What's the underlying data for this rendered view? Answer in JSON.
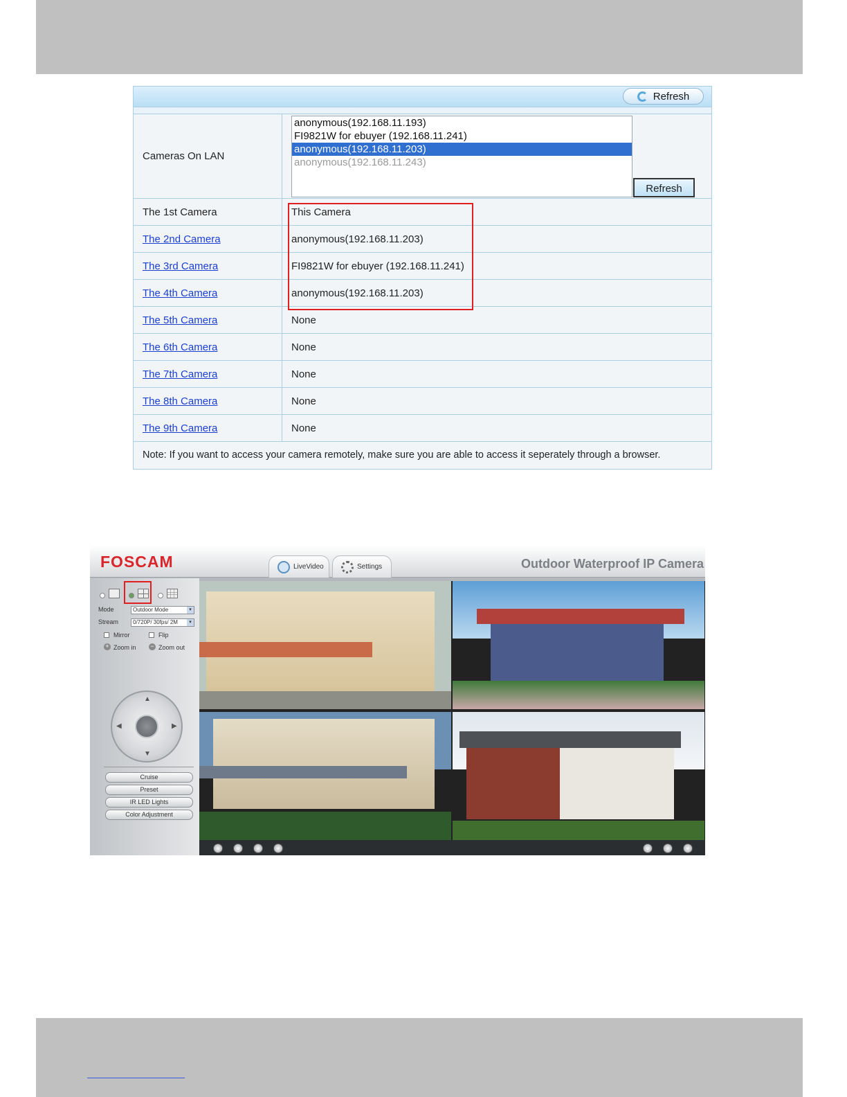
{
  "multi_device": {
    "toolbar_refresh_label": "Refresh",
    "cameras_on_lan_label": "Cameras On LAN",
    "lan_list": [
      {
        "text": "anonymous(192.168.11.193)",
        "state": "normal"
      },
      {
        "text": "FI9821W for ebuyer (192.168.11.241)",
        "state": "normal"
      },
      {
        "text": "anonymous(192.168.11.203)",
        "state": "selected"
      },
      {
        "text": "anonymous(192.168.11.243)",
        "state": "dimmed"
      }
    ],
    "side_refresh_label": "Refresh",
    "rows": [
      {
        "label": "The 1st Camera",
        "value": "This Camera",
        "link": false
      },
      {
        "label": "The 2nd Camera",
        "value": "anonymous(192.168.11.203)",
        "link": true
      },
      {
        "label": "The 3rd Camera",
        "value": "FI9821W for ebuyer (192.168.11.241)",
        "link": true
      },
      {
        "label": "The 4th Camera",
        "value": "anonymous(192.168.11.203)",
        "link": true
      },
      {
        "label": "The 5th Camera",
        "value": "None",
        "link": true
      },
      {
        "label": "The 6th Camera",
        "value": "None",
        "link": true
      },
      {
        "label": "The 7th Camera",
        "value": "None",
        "link": true
      },
      {
        "label": "The 8th Camera",
        "value": "None",
        "link": true
      },
      {
        "label": "The 9th Camera",
        "value": "None",
        "link": true
      }
    ],
    "note": "Note: If you want to access your camera remotely, make sure you are able to access it seperately through a browser."
  },
  "camera_ui": {
    "logo": "FOSCAM",
    "tabs": {
      "live_video": "LiveVideo",
      "settings": "Settings"
    },
    "title": "Outdoor Waterproof IP Camera",
    "mode_label": "Mode",
    "mode_value": "Outdoor Mode",
    "stream_label": "Stream",
    "stream_value": "0/720P/ 30fps/ 2M",
    "mirror_label": "Mirror",
    "flip_label": "Flip",
    "zoom_in_label": "Zoom in",
    "zoom_out_label": "Zoom out",
    "buttons": {
      "cruise": "Cruise",
      "preset": "Preset",
      "ir_led": "IR LED Lights",
      "color": "Color Adjustment"
    },
    "colors": {
      "brand_red": "#d8262b",
      "highlight_red": "#e02020",
      "selection_blue": "#2f6fd0"
    }
  }
}
